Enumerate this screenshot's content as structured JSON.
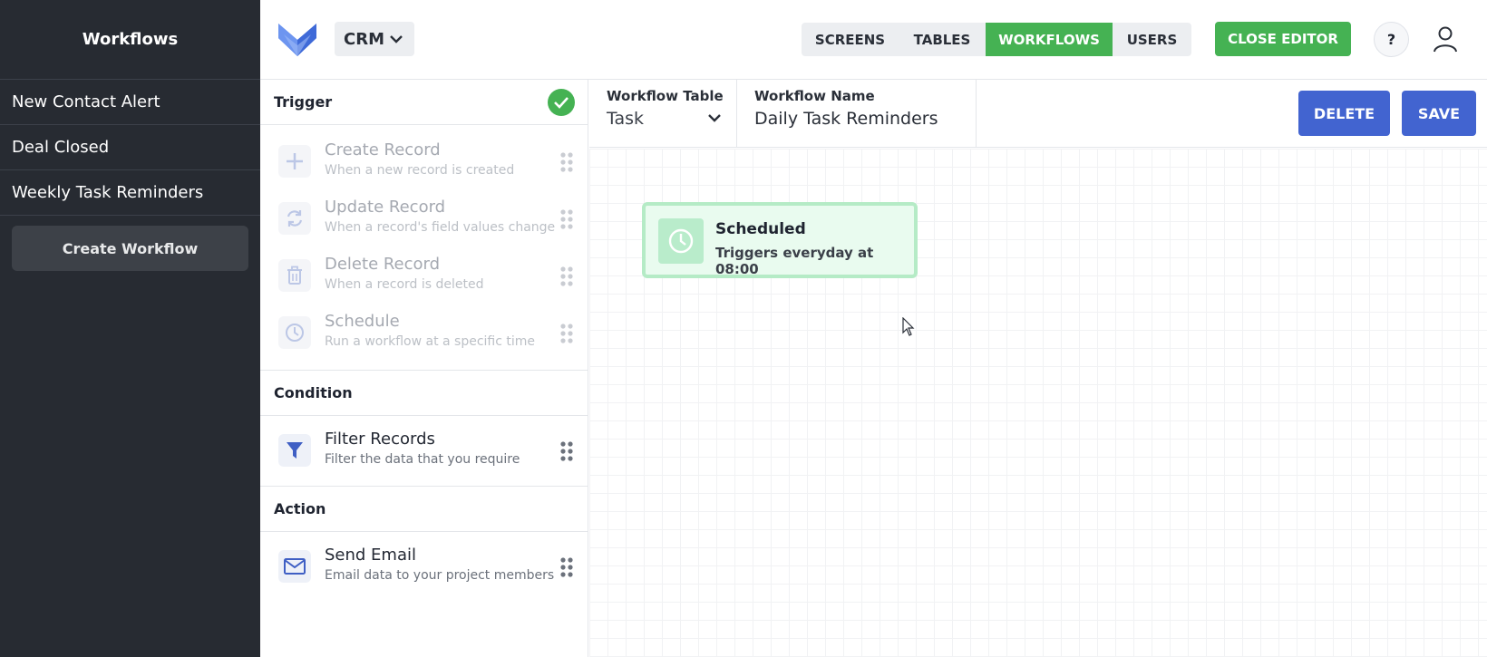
{
  "sidebar": {
    "title": "Workflows",
    "items": [
      {
        "label": "New Contact Alert"
      },
      {
        "label": "Deal Closed"
      },
      {
        "label": "Weekly Task Reminders"
      }
    ],
    "create_label": "Create Workflow"
  },
  "header": {
    "app_name": "CRM",
    "tabs": [
      {
        "label": "SCREENS",
        "active": false
      },
      {
        "label": "TABLES",
        "active": false
      },
      {
        "label": "WORKFLOWS",
        "active": true
      },
      {
        "label": "USERS",
        "active": false
      }
    ],
    "close_editor_label": "CLOSE EDITOR",
    "help_label": "?"
  },
  "panel": {
    "trigger": {
      "title": "Trigger",
      "blocks": [
        {
          "name": "Create Record",
          "desc": "When a new record is created",
          "icon": "plus-icon"
        },
        {
          "name": "Update Record",
          "desc": "When a record's field values change",
          "icon": "refresh-icon"
        },
        {
          "name": "Delete Record",
          "desc": "When a record is deleted",
          "icon": "trash-icon"
        },
        {
          "name": "Schedule",
          "desc": "Run a workflow at a specific time",
          "icon": "clock-icon"
        }
      ]
    },
    "condition": {
      "title": "Condition",
      "blocks": [
        {
          "name": "Filter Records",
          "desc": "Filter the data that you require",
          "icon": "filter-icon"
        }
      ]
    },
    "action": {
      "title": "Action",
      "blocks": [
        {
          "name": "Send Email",
          "desc": "Email data to your project members",
          "icon": "mail-icon"
        }
      ]
    }
  },
  "editor": {
    "table_label": "Workflow Table",
    "table_value": "Task",
    "name_label": "Workflow Name",
    "name_value": "Daily Task Reminders",
    "delete_label": "DELETE",
    "save_label": "SAVE"
  },
  "canvas": {
    "node": {
      "title": "Scheduled",
      "subtitle": "Triggers everyday at 08:00",
      "icon": "clock-icon"
    }
  },
  "colors": {
    "sidebar_bg": "#272b32",
    "accent_green": "#45b253",
    "primary_blue": "#4264d0",
    "node_bg": "#e9fbef"
  }
}
